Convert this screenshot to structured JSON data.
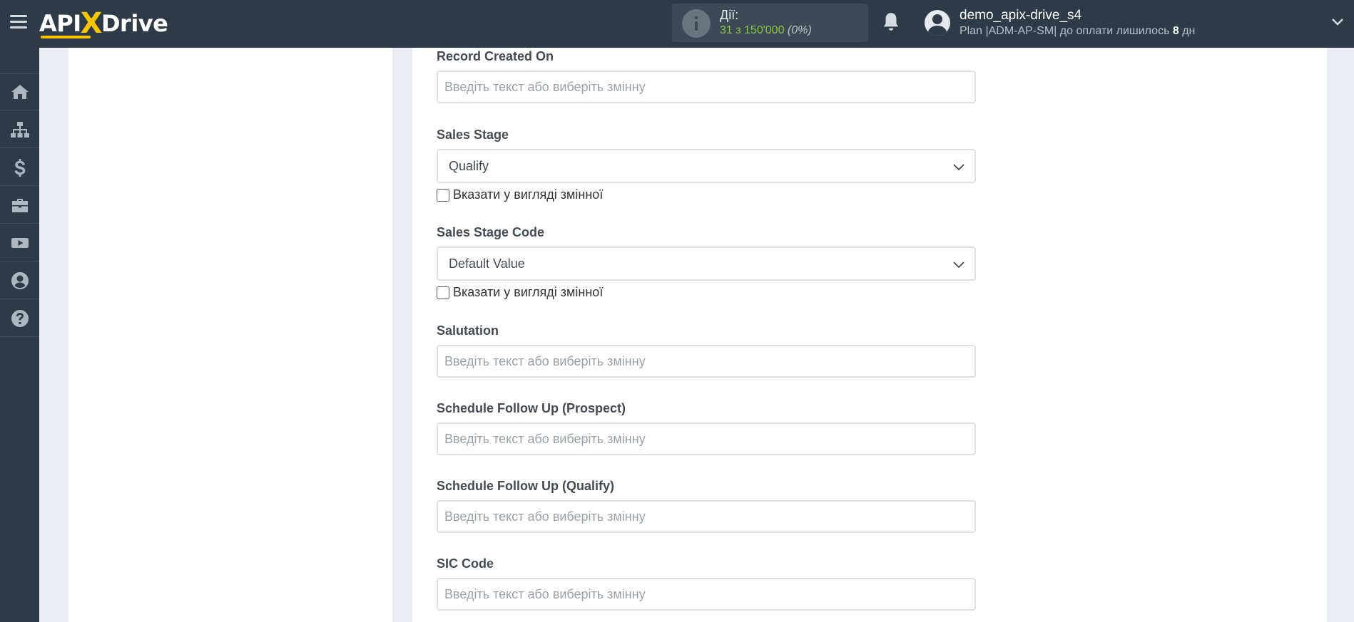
{
  "header": {
    "logo_left": "API",
    "logo_x": "X",
    "logo_right": "Drive",
    "actions": {
      "title": "Дії:",
      "count": "31 з 150'000",
      "percent": "(0%)"
    },
    "user": {
      "name": "demo_apix-drive_s4",
      "plan_prefix": "Plan |ADM-AP-SM| до оплати лишилось ",
      "days": "8",
      "plan_suffix": " дн"
    }
  },
  "sidebar": {
    "items": [
      {
        "icon": "home-icon"
      },
      {
        "icon": "sitemap-icon"
      },
      {
        "icon": "dollar-icon"
      },
      {
        "icon": "briefcase-icon"
      },
      {
        "icon": "youtube-icon"
      },
      {
        "icon": "user-circle-icon"
      },
      {
        "icon": "question-circle-icon"
      }
    ]
  },
  "form": {
    "record_created_on": {
      "label": "Record Created On",
      "placeholder": "Введіть текст або виберіть змінну",
      "value": ""
    },
    "sales_stage": {
      "label": "Sales Stage",
      "value": "Qualify",
      "checkbox_label": "Вказати у вигляді змінної",
      "checked": false
    },
    "sales_stage_code": {
      "label": "Sales Stage Code",
      "value": "Default Value",
      "checkbox_label": "Вказати у вигляді змінної",
      "checked": false
    },
    "salutation": {
      "label": "Salutation",
      "placeholder": "Введіть текст або виберіть змінну",
      "value": ""
    },
    "schedule_follow_up_prospect": {
      "label": "Schedule Follow Up (Prospect)",
      "placeholder": "Введіть текст або виберіть змінну",
      "value": ""
    },
    "schedule_follow_up_qualify": {
      "label": "Schedule Follow Up (Qualify)",
      "placeholder": "Введіть текст або виберіть змінну",
      "value": ""
    },
    "sic_code": {
      "label": "SIC Code",
      "placeholder": "Введіть текст або виберіть змінну",
      "value": ""
    }
  },
  "colors": {
    "topbar": "#2d3a47",
    "accent_yellow": "#f6c400",
    "count_green": "#8cc63f",
    "background": "#e9edf1"
  }
}
